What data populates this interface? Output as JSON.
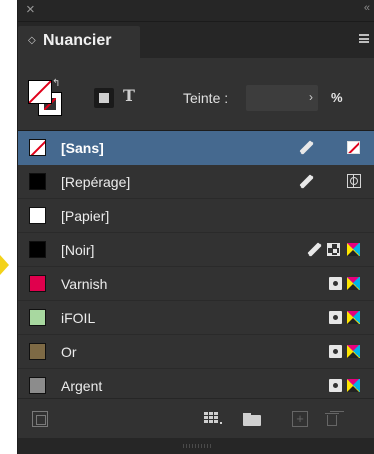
{
  "panel": {
    "tab_label": "Nuancier",
    "close_glyph": "×",
    "tab_chevron": "◇",
    "menu_icon": "hamburger-menu-icon"
  },
  "controls": {
    "tint_label": "Teinte :",
    "tint_value": "",
    "tint_arrow": "›",
    "tint_unit": "%",
    "text_toggle": "T"
  },
  "swatches": [
    {
      "name": "[Sans]",
      "color": "none",
      "selected": true,
      "icons": [
        "no-edit-icon",
        "none-swatch-icon"
      ]
    },
    {
      "name": "[Repérage]",
      "color": "#000000",
      "selected": false,
      "icons": [
        "no-edit-icon",
        "registration-icon"
      ]
    },
    {
      "name": "[Papier]",
      "color": "#ffffff",
      "selected": false,
      "icons": []
    },
    {
      "name": "[Noir]",
      "color": "#000000",
      "selected": false,
      "icons": [
        "no-edit-icon",
        "process-grid-icon",
        "cmyk-icon"
      ]
    },
    {
      "name": "Varnish",
      "color": "#e0004d",
      "selected": false,
      "icons": [
        "spot-color-icon",
        "cmyk-icon"
      ]
    },
    {
      "name": "iFOIL",
      "color": "#a8d8a0",
      "selected": false,
      "icons": [
        "spot-color-icon",
        "cmyk-icon"
      ]
    },
    {
      "name": "Or",
      "color": "#7e6a45",
      "selected": false,
      "icons": [
        "spot-color-icon",
        "cmyk-icon"
      ]
    },
    {
      "name": "Argent",
      "color": "#8c8c8c",
      "selected": false,
      "icons": [
        "spot-color-icon",
        "cmyk-icon"
      ]
    }
  ],
  "footer": {
    "icons": [
      "new-color-group-icon",
      "new-swatch-icon",
      "folder-icon",
      "add-icon",
      "trash-icon"
    ]
  },
  "colors": {
    "panel_bg": "#323232",
    "selected_row": "#45698f",
    "none_red": "#e0001a"
  }
}
